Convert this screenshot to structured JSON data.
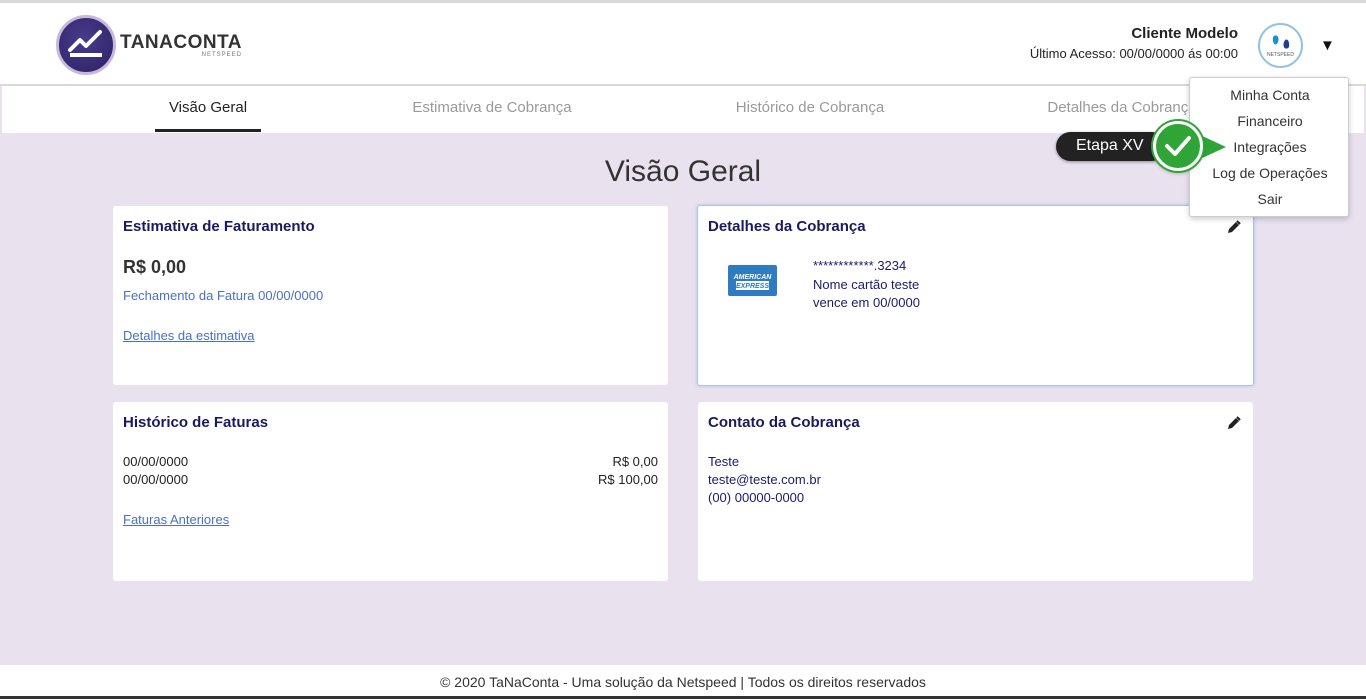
{
  "header": {
    "brand": "TANACONTA",
    "brand_sub": "NETSPEED",
    "user_name": "Cliente Modelo",
    "last_access": "Último Acesso: 00/00/0000 ás 00:00",
    "avatar_label": "NETSPEED"
  },
  "tabs": [
    {
      "label": "Visão Geral",
      "active": true
    },
    {
      "label": "Estimativa de Cobrança",
      "active": false
    },
    {
      "label": "Histórico de Cobrança",
      "active": false
    },
    {
      "label": "Detalhes da Cobrança",
      "active": false
    }
  ],
  "page_title": "Visão Geral",
  "cards": {
    "estimativa": {
      "title": "Estimativa de Faturamento",
      "amount": "R$ 0,00",
      "closing": "Fechamento da Fatura 00/00/0000",
      "link": "Detalhes da estimativa"
    },
    "detalhes": {
      "title": "Detalhes da Cobrança",
      "card_number": "************.3234",
      "card_name": "Nome cartão teste",
      "expiry": "vence em  00/0000",
      "card_brand": "AMERICAN EXPRESS"
    },
    "historico": {
      "title": "Histórico de Faturas",
      "rows": [
        {
          "date": "00/00/0000",
          "value": "R$ 0,00"
        },
        {
          "date": "00/00/0000",
          "value": "R$ 100,00"
        }
      ],
      "link": "Faturas Anteriores"
    },
    "contato": {
      "title": "Contato da Cobrança",
      "name": "Teste",
      "email": "teste@teste.com.br",
      "phone": "(00) 00000-0000"
    }
  },
  "dropdown": {
    "items": [
      "Minha Conta",
      "Financeiro",
      "Integrações",
      "Log de Operações",
      "Sair"
    ]
  },
  "step_badge": "Etapa XV",
  "footer": "© 2020 TaNaConta - Uma solução da Netspeed | Todos os direitos reservados",
  "colors": {
    "background": "#e9e1ee",
    "card_title": "#1a1a5e",
    "link": "#4a6fc9",
    "step_green": "#2fa437"
  }
}
